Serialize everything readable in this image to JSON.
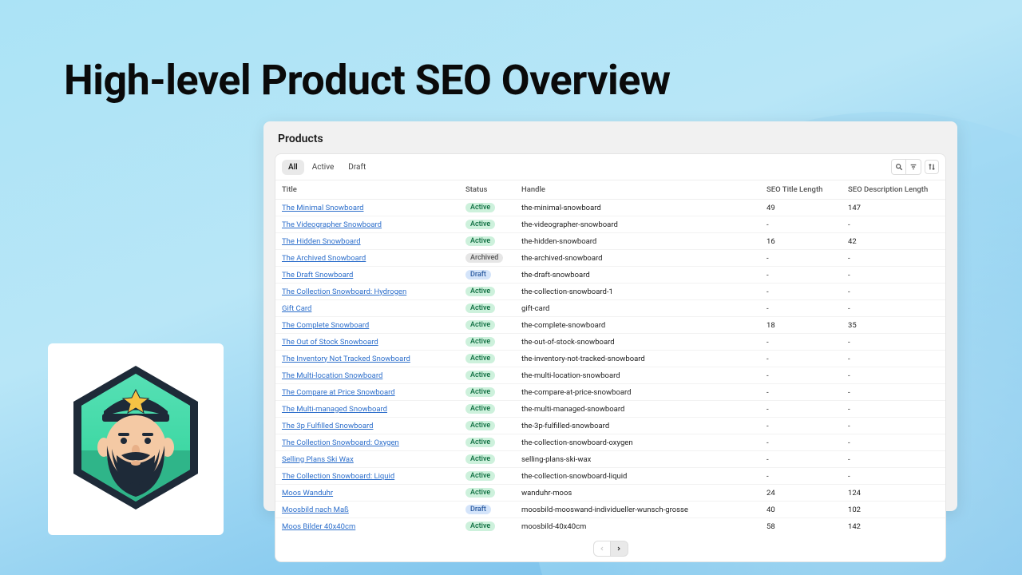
{
  "headline": "High-level Product SEO Overview",
  "panel_title": "Products",
  "tabs": [
    {
      "label": "All",
      "active": true
    },
    {
      "label": "Active",
      "active": false
    },
    {
      "label": "Draft",
      "active": false
    }
  ],
  "columns": {
    "title": "Title",
    "status": "Status",
    "handle": "Handle",
    "seo_title_length": "SEO Title Length",
    "seo_desc_length": "SEO Description Length"
  },
  "rows": [
    {
      "title": "The Minimal Snowboard",
      "status": "Active",
      "handle": "the-minimal-snowboard",
      "seot": "49",
      "seod": "147"
    },
    {
      "title": "The Videographer Snowboard",
      "status": "Active",
      "handle": "the-videographer-snowboard",
      "seot": "-",
      "seod": "-"
    },
    {
      "title": "The Hidden Snowboard",
      "status": "Active",
      "handle": "the-hidden-snowboard",
      "seot": "16",
      "seod": "42"
    },
    {
      "title": "The Archived Snowboard",
      "status": "Archived",
      "handle": "the-archived-snowboard",
      "seot": "-",
      "seod": "-"
    },
    {
      "title": "The Draft Snowboard",
      "status": "Draft",
      "handle": "the-draft-snowboard",
      "seot": "-",
      "seod": "-"
    },
    {
      "title": "The Collection Snowboard: Hydrogen",
      "status": "Active",
      "handle": "the-collection-snowboard-1",
      "seot": "-",
      "seod": "-"
    },
    {
      "title": "Gift Card",
      "status": "Active",
      "handle": "gift-card",
      "seot": "-",
      "seod": "-"
    },
    {
      "title": "The Complete Snowboard",
      "status": "Active",
      "handle": "the-complete-snowboard",
      "seot": "18",
      "seod": "35"
    },
    {
      "title": "The Out of Stock Snowboard",
      "status": "Active",
      "handle": "the-out-of-stock-snowboard",
      "seot": "-",
      "seod": "-"
    },
    {
      "title": "The Inventory Not Tracked Snowboard",
      "status": "Active",
      "handle": "the-inventory-not-tracked-snowboard",
      "seot": "-",
      "seod": "-"
    },
    {
      "title": "The Multi-location Snowboard",
      "status": "Active",
      "handle": "the-multi-location-snowboard",
      "seot": "-",
      "seod": "-"
    },
    {
      "title": "The Compare at Price Snowboard",
      "status": "Active",
      "handle": "the-compare-at-price-snowboard",
      "seot": "-",
      "seod": "-"
    },
    {
      "title": "The Multi-managed Snowboard",
      "status": "Active",
      "handle": "the-multi-managed-snowboard",
      "seot": "-",
      "seod": "-"
    },
    {
      "title": "The 3p Fulfilled Snowboard",
      "status": "Active",
      "handle": "the-3p-fulfilled-snowboard",
      "seot": "-",
      "seod": "-"
    },
    {
      "title": "The Collection Snowboard: Oxygen",
      "status": "Active",
      "handle": "the-collection-snowboard-oxygen",
      "seot": "-",
      "seod": "-"
    },
    {
      "title": "Selling Plans Ski Wax",
      "status": "Active",
      "handle": "selling-plans-ski-wax",
      "seot": "-",
      "seod": "-"
    },
    {
      "title": "The Collection Snowboard: Liquid",
      "status": "Active",
      "handle": "the-collection-snowboard-liquid",
      "seot": "-",
      "seod": "-"
    },
    {
      "title": "Moos Wanduhr",
      "status": "Active",
      "handle": "wanduhr-moos",
      "seot": "24",
      "seod": "124"
    },
    {
      "title": "Moosbild nach Maß",
      "status": "Draft",
      "handle": "moosbild-mooswand-individueller-wunsch-grosse",
      "seot": "40",
      "seod": "102"
    },
    {
      "title": "Moos Bilder 40x40cm",
      "status": "Active",
      "handle": "moosbild-40x40cm",
      "seot": "58",
      "seod": "142"
    }
  ]
}
